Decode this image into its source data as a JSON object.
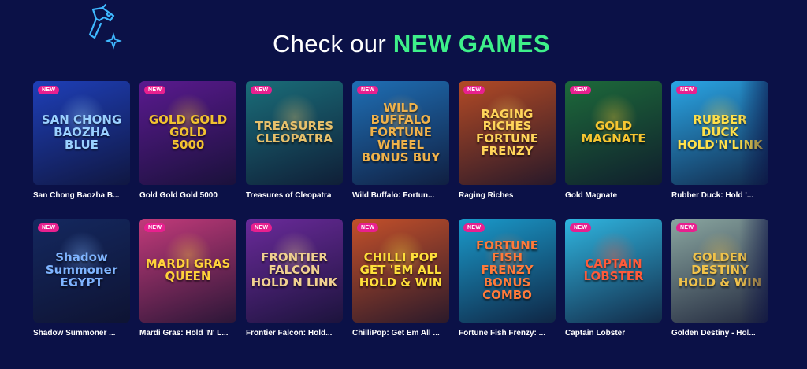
{
  "header": {
    "prefix": "Check our",
    "highlight": "NEW GAMES"
  },
  "icons": {
    "decor": "neon-ray-gun-icon",
    "sparkle": "sparkle-icon"
  },
  "colors": {
    "background": "#0b1147",
    "highlight": "#3ef08a",
    "badge": "#e8208f"
  },
  "games": [
    {
      "title": "San Chong Baozha B...",
      "art": "SAN CHONG\nBAOZHA\nBLUE",
      "badge": "NEW",
      "bg": "#1e3fb8",
      "accent": "#9ad0ff"
    },
    {
      "title": "Gold Gold Gold 5000",
      "art": "GOLD GOLD GOLD\n5000",
      "badge": "NEW",
      "bg": "#5a1a8f",
      "accent": "#f2c230"
    },
    {
      "title": "Treasures of Cleopatra",
      "art": "TREASURES\nCLEOPATRA",
      "badge": "NEW",
      "bg": "#1a6d79",
      "accent": "#e7c06b"
    },
    {
      "title": "Wild Buffalo: Fortun...",
      "art": "WILD\nBUFFALO\nFORTUNE WHEEL\nBONUS BUY",
      "badge": "NEW",
      "bg": "#1f6fb5",
      "accent": "#f0b24a"
    },
    {
      "title": "Raging Riches",
      "art": "RAGING\nRICHES\nFORTUNE FRENZY",
      "badge": "NEW",
      "bg": "#b34a25",
      "accent": "#ffd45a"
    },
    {
      "title": "Gold Magnate",
      "art": "GOLD\nMAGNATE",
      "badge": "NEW",
      "bg": "#1d6a3a",
      "accent": "#f5c531"
    },
    {
      "title": "Rubber Duck: Hold '...",
      "art": "RUBBER\nDUCK\nHOLD'N'LINK",
      "badge": "NEW",
      "bg": "#2aa6e6",
      "accent": "#ffe04a"
    },
    {
      "title": "Shadow Summoner ...",
      "art": "Shadow Summoner\nEGYPT",
      "badge": "NEW",
      "bg": "#14285f",
      "accent": "#7fb4ff"
    },
    {
      "title": "Mardi Gras: Hold 'N' L...",
      "art": "MARDI GRAS\nQUEEN",
      "badge": "NEW",
      "bg": "#c23a7a",
      "accent": "#ffd23a"
    },
    {
      "title": "Frontier Falcon: Hold...",
      "art": "FRONTIER\nFALCON\nHOLD N LINK",
      "badge": "NEW",
      "bg": "#6a2a9a",
      "accent": "#f0d090"
    },
    {
      "title": "ChilliPop: Get Em All ...",
      "art": "CHILLI POP\nGET 'EM ALL\nHOLD & WIN",
      "badge": "NEW",
      "bg": "#c4502a",
      "accent": "#ffe03a"
    },
    {
      "title": "Fortune Fish Frenzy: ...",
      "art": "FORTUNE FISH\nFRENZY\nBONUS COMBO",
      "badge": "NEW",
      "bg": "#1a9acb",
      "accent": "#ff7a3a"
    },
    {
      "title": "Captain Lobster",
      "art": "CAPTAIN\nLOBSTER",
      "badge": "NEW",
      "bg": "#2fb5e0",
      "accent": "#ff5a3a"
    },
    {
      "title": "Golden Destiny - Hol...",
      "art": "GOLDEN\nDESTINY\nHOLD & WIN",
      "badge": "NEW",
      "bg": "#8aa6a0",
      "accent": "#f0c24a"
    }
  ]
}
